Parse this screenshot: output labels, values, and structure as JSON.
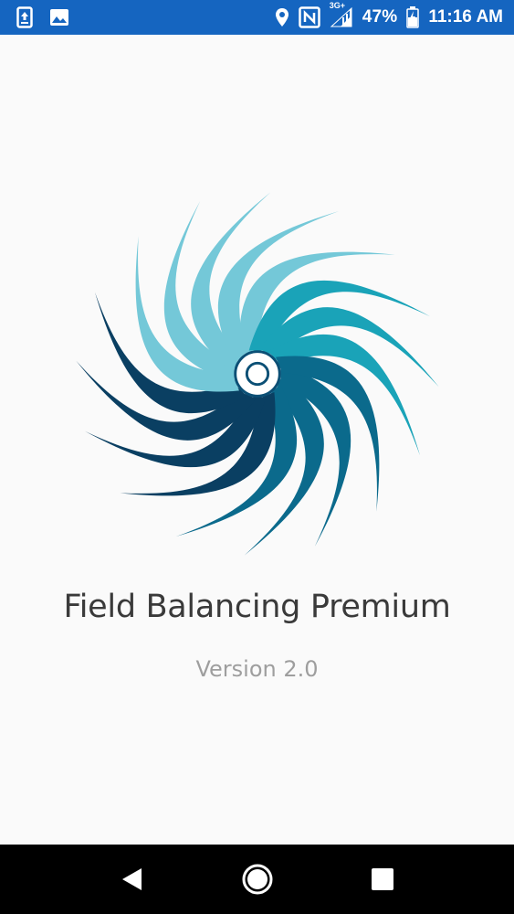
{
  "status_bar": {
    "network_label": "3G+",
    "battery_percent": "47%",
    "time": "11:16 AM",
    "color": "#1565c0",
    "icons": [
      "upload-notification-icon",
      "image-notification-icon",
      "location-icon",
      "nfc-icon",
      "signal-icon",
      "battery-icon"
    ]
  },
  "splash": {
    "app_name": "Field Balancing Premium",
    "version": "Version 2.0",
    "logo_colors": [
      "#74c8d8",
      "#1aa3b8",
      "#0b6a8c",
      "#0a3f62"
    ]
  },
  "nav_bar": {
    "icons": [
      "back-icon",
      "home-icon",
      "recents-icon"
    ]
  }
}
